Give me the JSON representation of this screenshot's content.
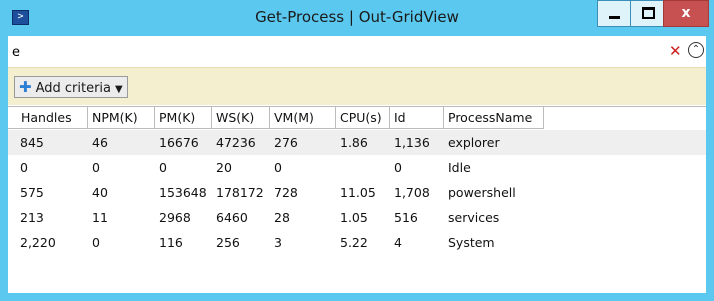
{
  "window": {
    "title": "Get-Process | Out-GridView",
    "icon": "powershell-icon",
    "close_glyph": "x"
  },
  "search": {
    "value": "e",
    "clear_icon": "x",
    "collapse_icon": "chevron-up-circle"
  },
  "criteria": {
    "add_label": "Add criteria"
  },
  "table": {
    "columns": [
      "Handles",
      "NPM(K)",
      "PM(K)",
      "WS(K)",
      "VM(M)",
      "CPU(s)",
      "Id",
      "ProcessName"
    ],
    "rows": [
      [
        "845",
        "46",
        "16676",
        "47236",
        "276",
        "1.86",
        "1,136",
        "explorer"
      ],
      [
        "0",
        "0",
        "0",
        "20",
        "0",
        "",
        "0",
        "Idle"
      ],
      [
        "575",
        "40",
        "153648",
        "178172",
        "728",
        "11.05",
        "1,708",
        "powershell"
      ],
      [
        "213",
        "11",
        "2968",
        "6460",
        "28",
        "1.05",
        "516",
        "services"
      ],
      [
        "2,220",
        "0",
        "116",
        "256",
        "3",
        "5.22",
        "4",
        "System"
      ]
    ],
    "selected_row": 0
  },
  "colors": {
    "titlebar": "#5bc8ef",
    "criteria_bar": "#f4efcf",
    "close_button": "#c75050"
  }
}
